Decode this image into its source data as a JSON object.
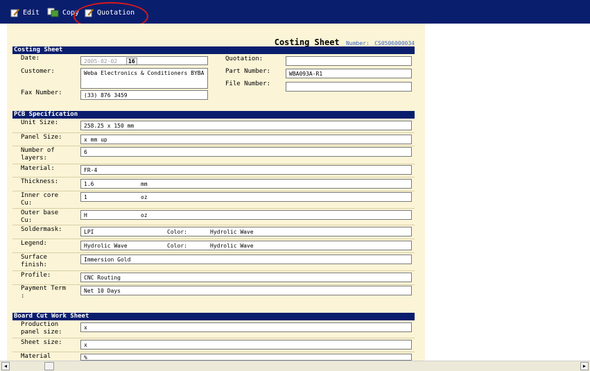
{
  "toolbar": {
    "edit": "Edit",
    "copy": "Copy",
    "quotation": "Quotation"
  },
  "sheet": {
    "title": "Costing Sheet",
    "number_label": "Number:",
    "number": "CS0506000034"
  },
  "costing": {
    "section": "Costing Sheet",
    "date_label": "Date:",
    "date": "2005-02-02",
    "date_btn": "16",
    "customer_label": "Customer:",
    "customer": "Weba Electronics & Conditioners BYBA",
    "fax_label": "Fax Number:",
    "fax": "(33) 876 3459",
    "quotation_label": "Quotation:",
    "quotation": "",
    "part_label": "Part Number:",
    "part": "WBA093A-R1",
    "file_label": "File Number:",
    "file": ""
  },
  "pcb": {
    "section": "PCB Specification",
    "unit_label": "Unit Size:",
    "unit": "258.25 x 150 mm",
    "panel_label": "Panel Size:",
    "panel": "x  mm  up",
    "layers_label": "Number of layers:",
    "layers": "6",
    "material_label": "Material:",
    "material": "FR-4",
    "thickness_label": "Thickness:",
    "thickness": "1.6",
    "thickness_unit": "mm",
    "inner_label": "Inner core Cu:",
    "inner": "1",
    "inner_unit": "oz",
    "outer_label": "Outer base Cu:",
    "outer": "H",
    "outer_unit": "oz",
    "solder_label": "Soldermask:",
    "solder": "LPI",
    "solder_color_label": "Color:",
    "solder_color": "Hydrolic Wave",
    "legend_label": "Legend:",
    "legend": "Hydrolic Wave",
    "legend_color_label": "Color:",
    "legend_color": "Hydrolic Wave",
    "surface_label": "Surface finish:",
    "surface": "Immersion Gold",
    "profile_label": "Profile:",
    "profile": "CNC Routing",
    "payment_label": "Payment Term :",
    "payment": "Net 10 Days"
  },
  "board": {
    "section": "Board Cut Work Sheet",
    "prod_label": "Production panel size:",
    "prod": "x",
    "sheet_label": "Sheet size:",
    "sheet": "x",
    "mat_label": "Material",
    "mat": "%"
  }
}
